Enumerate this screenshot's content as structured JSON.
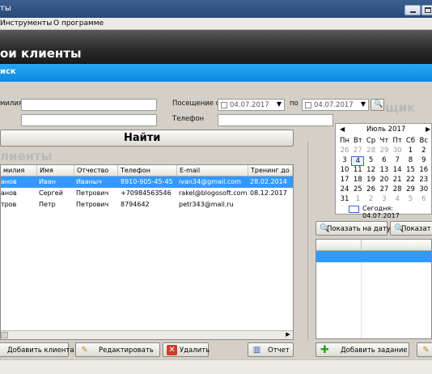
{
  "window": {
    "title": "ты"
  },
  "menu": {
    "tools": "Инструменты",
    "about": "О программе"
  },
  "header": {
    "title": "ои клиенты"
  },
  "bluebar": {
    "label": "иск"
  },
  "filters": {
    "surname_label": "милия",
    "visit_label": "Посещение с",
    "visit_from": "04.07.2017",
    "to_label": "по",
    "visit_to": "04.07.2017",
    "phone_label": "Телефон",
    "find_button": "Найти"
  },
  "section_clients": "лиенты",
  "section_right": "щик",
  "clients_table": {
    "headers": [
      "милия",
      "Имя",
      "Отчество",
      "Телефон",
      "E-mail",
      "Тренинг до"
    ],
    "rows": [
      [
        "анов",
        "Иван",
        "Иваныч",
        "8910-905-45-45",
        "ivan34@gmail.com",
        "28.02.2014"
      ],
      [
        "анов",
        "Сергей",
        "Петрович",
        "+70984563546",
        "rakel@blogosoft.com",
        "08.12.2017"
      ],
      [
        "тров",
        "Петр",
        "Петрович",
        "8794642",
        "petr343@mail.ru",
        ""
      ]
    ]
  },
  "calendar": {
    "month": "Июль 2017",
    "weekdays": [
      "Пн",
      "Вт",
      "Ср",
      "Чт",
      "Пт",
      "Сб",
      "Вс"
    ],
    "weeks": [
      [
        "26",
        "27",
        "28",
        "29",
        "30",
        "1",
        "2"
      ],
      [
        "3",
        "4",
        "5",
        "6",
        "7",
        "8",
        "9"
      ],
      [
        "10",
        "11",
        "12",
        "13",
        "14",
        "15",
        "16"
      ],
      [
        "17",
        "18",
        "19",
        "20",
        "21",
        "22",
        "23"
      ],
      [
        "24",
        "25",
        "26",
        "27",
        "28",
        "29",
        "30"
      ],
      [
        "31",
        "1",
        "2",
        "3",
        "4",
        "5",
        "6"
      ]
    ],
    "today": "Сегодня: 04.07.2017"
  },
  "buttons": {
    "add_client": "Добавить клиента",
    "edit": "Редактировать",
    "delete": "Удалить",
    "report": "Отчет",
    "show_by_date": "Показать на дату",
    "show": "Показат",
    "add_task": "Добавить задание"
  }
}
